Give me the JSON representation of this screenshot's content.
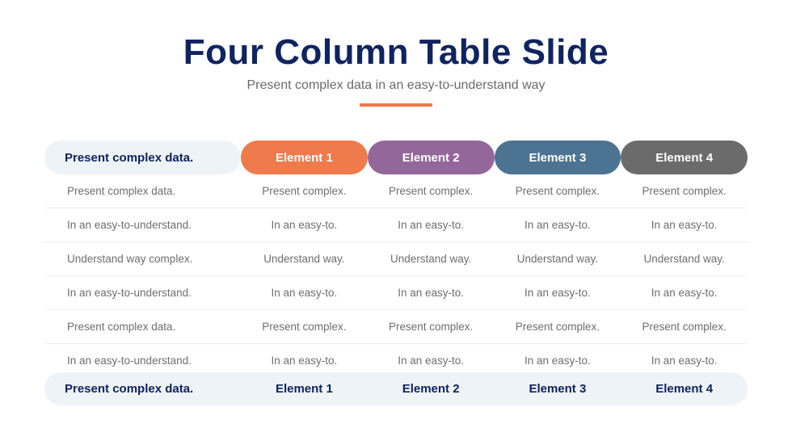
{
  "header": {
    "title": "Four Column Table Slide",
    "subtitle": "Present complex data in an easy-to-understand way",
    "accent_color": "#e8794f"
  },
  "table": {
    "header_first": "Present complex data.",
    "columns": [
      {
        "label": "Element 1",
        "color": "#ef7a4b"
      },
      {
        "label": "Element 2",
        "color": "#94679a"
      },
      {
        "label": "Element 3",
        "color": "#4c7391"
      },
      {
        "label": "Element 4",
        "color": "#6b6b6b"
      }
    ],
    "rows": [
      {
        "label": "Present complex data.",
        "cells": [
          "Present complex.",
          "Present complex.",
          "Present complex.",
          "Present complex."
        ]
      },
      {
        "label": "In an easy-to-understand.",
        "cells": [
          "In an easy-to.",
          "In an easy-to.",
          "In an easy-to.",
          "In an easy-to."
        ]
      },
      {
        "label": "Understand way complex.",
        "cells": [
          "Understand way.",
          "Understand way.",
          "Understand way.",
          "Understand way."
        ]
      },
      {
        "label": "In an easy-to-understand.",
        "cells": [
          "In an easy-to.",
          "In an easy-to.",
          "In an easy-to.",
          "In an easy-to."
        ]
      },
      {
        "label": "Present complex data.",
        "cells": [
          "Present complex.",
          "Present complex.",
          "Present complex.",
          "Present complex."
        ]
      },
      {
        "label": "In an easy-to-understand.",
        "cells": [
          "In an easy-to.",
          "In an easy-to.",
          "In an easy-to.",
          "In an easy-to."
        ]
      }
    ],
    "footer": {
      "label": "Present complex data.",
      "cells": [
        "Element 1",
        "Element 2",
        "Element 3",
        "Element 4"
      ]
    }
  }
}
